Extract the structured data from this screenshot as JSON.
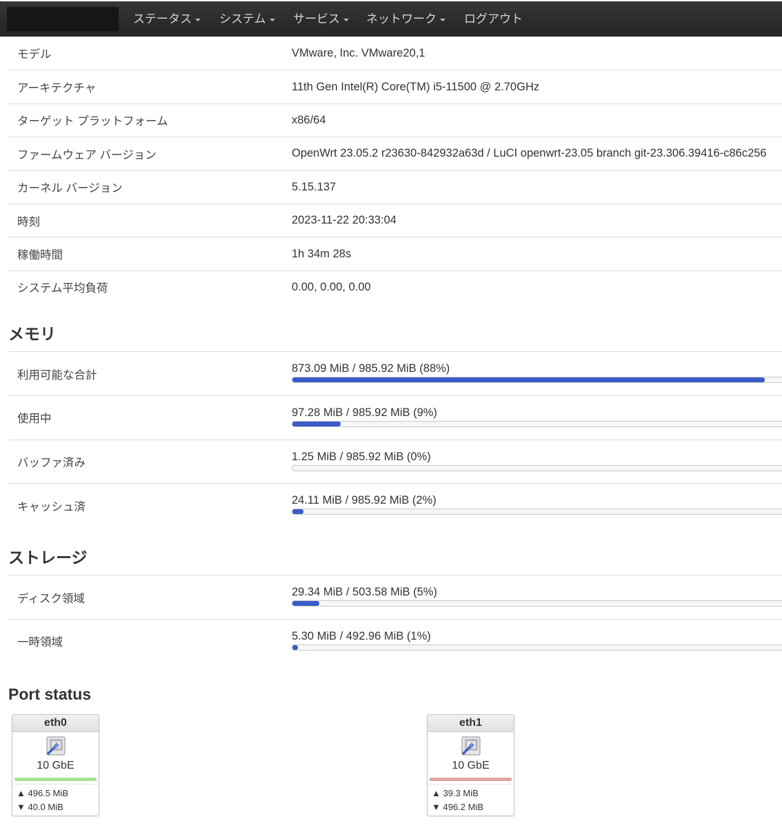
{
  "nav": {
    "menu": [
      {
        "label": "ステータス"
      },
      {
        "label": "システム"
      },
      {
        "label": "サービス"
      },
      {
        "label": "ネットワーク"
      },
      {
        "label": "ログアウト"
      }
    ]
  },
  "system": {
    "rows": [
      {
        "label": "モデル",
        "value": "VMware, Inc. VMware20,1"
      },
      {
        "label": "アーキテクチャ",
        "value": "11th Gen Intel(R) Core(TM) i5-11500 @ 2.70GHz"
      },
      {
        "label": "ターゲット プラットフォーム",
        "value": "x86/64"
      },
      {
        "label": "ファームウェア バージョン",
        "value": "OpenWrt 23.05.2 r23630-842932a63d / LuCI openwrt-23.05 branch git-23.306.39416-c86c256"
      },
      {
        "label": "カーネル バージョン",
        "value": "5.15.137"
      },
      {
        "label": "時刻",
        "value": "2023-11-22 20:33:04"
      },
      {
        "label": "稼働時間",
        "value": "1h 34m 28s"
      },
      {
        "label": "システム平均負荷",
        "value": "0.00, 0.00, 0.00"
      }
    ]
  },
  "memory": {
    "title": "メモリ",
    "rows": [
      {
        "label": "利用可能な合計",
        "value": "873.09 MiB / 985.92 MiB (88%)",
        "percent": 88
      },
      {
        "label": "使用中",
        "value": "97.28 MiB / 985.92 MiB (9%)",
        "percent": 9
      },
      {
        "label": "バッファ済み",
        "value": "1.25 MiB / 985.92 MiB (0%)",
        "percent": 0
      },
      {
        "label": "キャッシュ済",
        "value": "24.11 MiB / 985.92 MiB (2%)",
        "percent": 2
      }
    ]
  },
  "storage": {
    "title": "ストレージ",
    "rows": [
      {
        "label": "ディスク領域",
        "value": "29.34 MiB / 503.58 MiB (5%)",
        "percent": 5
      },
      {
        "label": "一時領域",
        "value": "5.30 MiB / 492.96 MiB (1%)",
        "percent": 1
      }
    ]
  },
  "port_status": {
    "title": "Port status",
    "ports": [
      {
        "name": "eth0",
        "icon": "ethernet-port-icon",
        "speed": "10 GbE",
        "zone_color": "#a7e394",
        "tx": "▲ 496.5 MiB",
        "rx": "▼ 40.0 MiB"
      },
      {
        "name": "eth1",
        "icon": "ethernet-port-icon",
        "speed": "10 GbE",
        "zone_color": "#e0a3a3",
        "tx": "▲ 39.3 MiB",
        "rx": "▼ 496.2 MiB"
      }
    ]
  },
  "theme": {
    "navbar_bg": "#242424",
    "progress_fill": "#3a5bc8"
  }
}
